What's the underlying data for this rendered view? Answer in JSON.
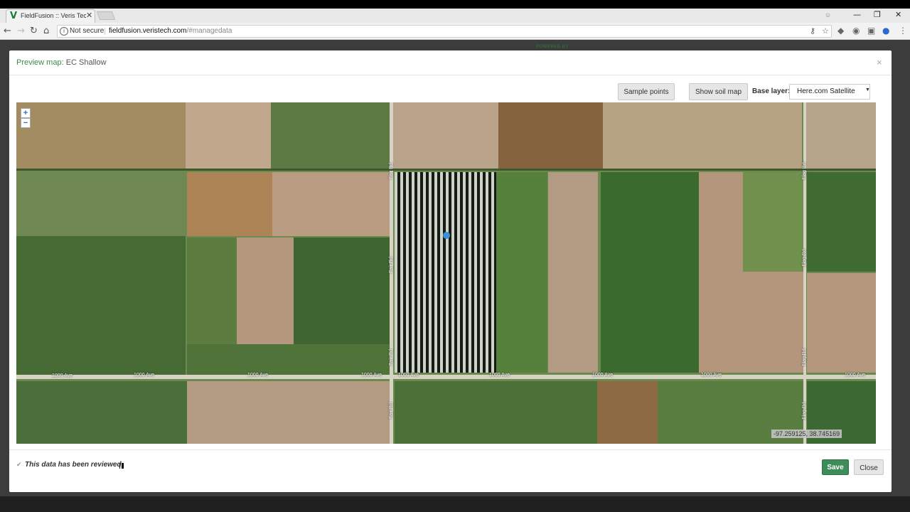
{
  "browser": {
    "tab_title": "FieldFusion :: Veris Techn",
    "tab_favicon": "V",
    "tab_close": "✕",
    "security_label": "Not secure",
    "url_host": "fieldfusion.veristech.com",
    "url_path": "/#managedata",
    "window_buttons": {
      "minimize": "—",
      "maximize": "❐",
      "close": "✕"
    },
    "nav_icons": {
      "back": "←",
      "forward": "→",
      "reload": "↻",
      "home": "⌂",
      "key": "⚷",
      "star": "☆"
    }
  },
  "background": {
    "powered_by": "POWERED BY"
  },
  "modal": {
    "title_prefix": "Preview map:",
    "title_name": "EC Shallow",
    "close_icon": "×",
    "toolbar": {
      "sample_points": "Sample points",
      "show_soil_map": "Show soil map",
      "base_layer_label": "Base layer:",
      "base_layer_value": "Here.com Satellite"
    },
    "map": {
      "zoom_in": "+",
      "zoom_out": "−",
      "coords": "-97.259125, 38.745169",
      "road_labels": {
        "ave_1": "1000 Ave",
        "ave_2": "1000 Ave",
        "ave_3": "1000 Ave",
        "ave_4": "1000 Ave",
        "ave_5": "1000 Ave",
        "ave_6": "1000 Ave",
        "ave_7": "1000 Ave",
        "ave_8": "1000 Ave",
        "ave_9": "1000 Ave",
        "fair_1": "Fair Rd",
        "fair_2": "Fair Rd",
        "fair_3": "Fair Rd",
        "fair_4": "Fair Rd",
        "flag_1": "Flag Rd",
        "flag_2": "Flag Rd",
        "flag_3": "Flag Rd",
        "flag_4": "Flag Rd"
      }
    },
    "footer": {
      "reviewed_text": "This data has been reviewed",
      "save": "Save",
      "close": "Close"
    }
  }
}
